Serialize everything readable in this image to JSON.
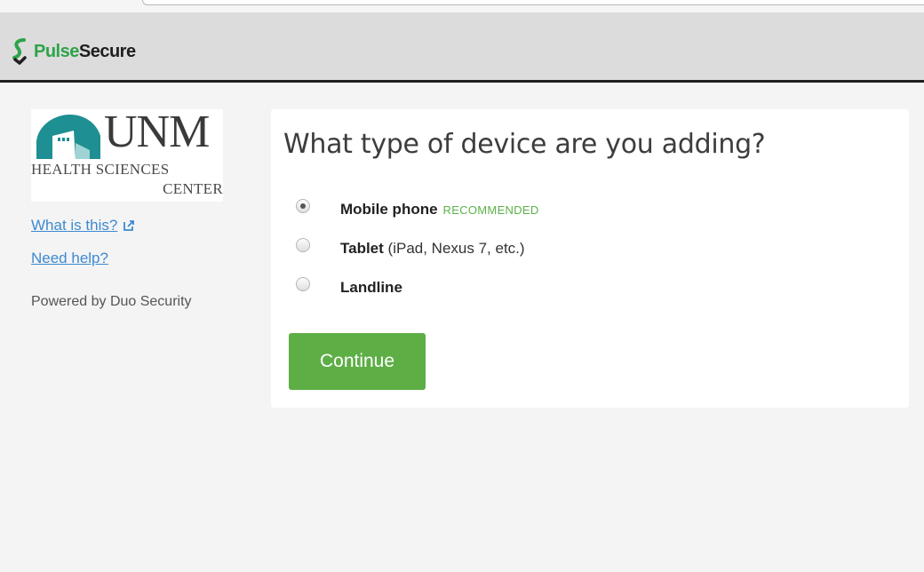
{
  "header": {
    "brand_pulse": "Pulse",
    "brand_secure": "Secure"
  },
  "sidebar": {
    "logo_unm": "UNM",
    "logo_line1": "HEALTH SCIENCES",
    "logo_line2": "CENTER",
    "what_is_this": "What is this?",
    "need_help": "Need help?",
    "powered_by": "Powered by Duo Security"
  },
  "card": {
    "title": "What type of device are you adding?",
    "options": [
      {
        "label": "Mobile phone",
        "detail": "",
        "badge": "RECOMMENDED",
        "selected": true
      },
      {
        "label": "Tablet",
        "detail": "(iPad, Nexus 7, etc.)",
        "badge": "",
        "selected": false
      },
      {
        "label": "Landline",
        "detail": "",
        "badge": "",
        "selected": false
      }
    ],
    "continue_label": "Continue"
  },
  "colors": {
    "brand_green": "#2ea34a",
    "button_green": "#5eae46",
    "link_blue": "#3d8ad1",
    "badge_green": "#5cb24a",
    "logo_teal": "#1e8f92"
  },
  "icons": {
    "brand": "pulse-secure-logo-icon",
    "external_link": "external-link-icon",
    "logo_dome": "unm-dome-icon"
  }
}
